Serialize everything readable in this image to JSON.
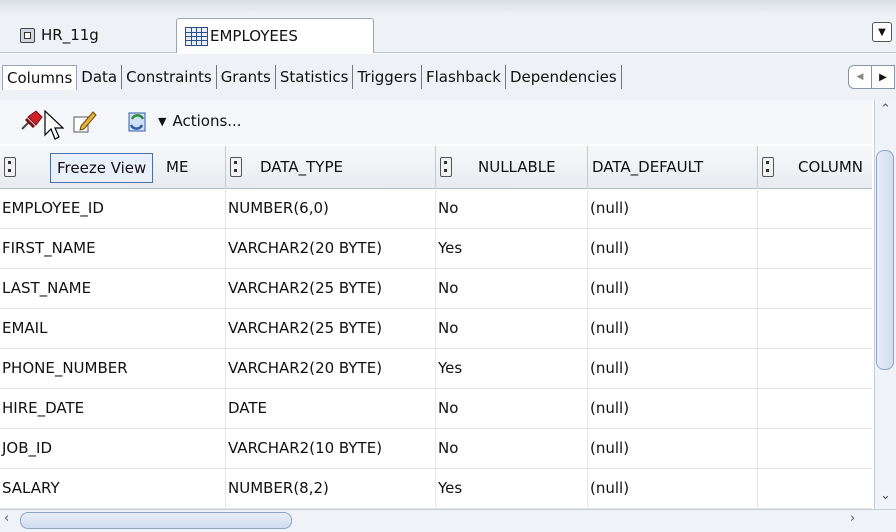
{
  "editor_tabs": [
    {
      "label": "HR_11g",
      "icon": "database-connection-icon"
    },
    {
      "label": "EMPLOYEES",
      "icon": "table-icon"
    }
  ],
  "sub_tabs": [
    "Columns",
    "Data",
    "Constraints",
    "Grants",
    "Statistics",
    "Triggers",
    "Flashback",
    "Dependencies"
  ],
  "active_sub_tab": "Columns",
  "toolbar": {
    "actions_label": "Actions...",
    "tooltip": "Freeze View"
  },
  "grid": {
    "columns": [
      "COLUMN_NAME",
      "DATA_TYPE",
      "NULLABLE",
      "DATA_DEFAULT",
      "COLUMN_ID"
    ],
    "visible_headers": [
      "ME",
      "DATA_TYPE",
      "NULLABLE",
      "DATA_DEFAULT",
      "COLUMN"
    ],
    "rows": [
      {
        "name": "EMPLOYEE_ID",
        "type": "NUMBER(6,0)",
        "nullable": "No",
        "default": "(null)"
      },
      {
        "name": "FIRST_NAME",
        "type": "VARCHAR2(20 BYTE)",
        "nullable": "Yes",
        "default": "(null)"
      },
      {
        "name": "LAST_NAME",
        "type": "VARCHAR2(25 BYTE)",
        "nullable": "No",
        "default": "(null)"
      },
      {
        "name": "EMAIL",
        "type": "VARCHAR2(25 BYTE)",
        "nullable": "No",
        "default": "(null)"
      },
      {
        "name": "PHONE_NUMBER",
        "type": "VARCHAR2(20 BYTE)",
        "nullable": "Yes",
        "default": "(null)"
      },
      {
        "name": "HIRE_DATE",
        "type": "DATE",
        "nullable": "No",
        "default": "(null)"
      },
      {
        "name": "JOB_ID",
        "type": "VARCHAR2(10 BYTE)",
        "nullable": "No",
        "default": "(null)"
      },
      {
        "name": "SALARY",
        "type": "NUMBER(8,2)",
        "nullable": "Yes",
        "default": "(null)"
      }
    ]
  },
  "colors": {
    "accent": "#4d6fa8",
    "tab_bar": "#eef1f5",
    "pin_red": "#d0202a"
  }
}
